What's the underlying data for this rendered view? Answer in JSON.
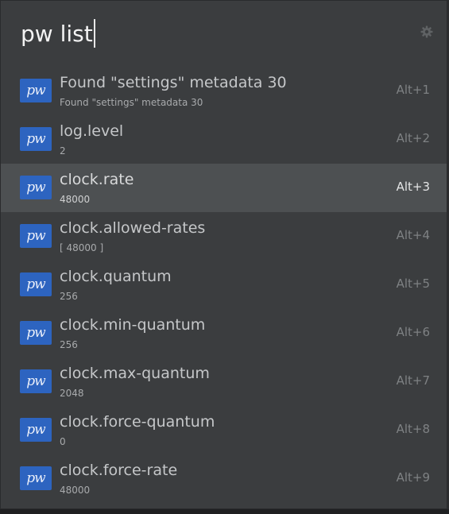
{
  "search": {
    "query": "pw list"
  },
  "icons": {
    "settings": "gear-icon",
    "app": "pipewire-icon"
  },
  "app_icon_label": "pw",
  "results": [
    {
      "title": "Found \"settings\" metadata 30",
      "subtitle": "Found \"settings\" metadata 30",
      "shortcut": "Alt+1",
      "selected": false
    },
    {
      "title": "log.level",
      "subtitle": "2",
      "shortcut": "Alt+2",
      "selected": false
    },
    {
      "title": "clock.rate",
      "subtitle": "48000",
      "shortcut": "Alt+3",
      "selected": true
    },
    {
      "title": "clock.allowed-rates",
      "subtitle": "[ 48000 ]",
      "shortcut": "Alt+4",
      "selected": false
    },
    {
      "title": "clock.quantum",
      "subtitle": "256",
      "shortcut": "Alt+5",
      "selected": false
    },
    {
      "title": "clock.min-quantum",
      "subtitle": "256",
      "shortcut": "Alt+6",
      "selected": false
    },
    {
      "title": "clock.max-quantum",
      "subtitle": "2048",
      "shortcut": "Alt+7",
      "selected": false
    },
    {
      "title": "clock.force-quantum",
      "subtitle": "0",
      "shortcut": "Alt+8",
      "selected": false
    },
    {
      "title": "clock.force-rate",
      "subtitle": "48000",
      "shortcut": "Alt+9",
      "selected": false
    }
  ],
  "colors": {
    "background": "#3b3d3f",
    "selected_row": "#4d5052",
    "icon_blue": "#2d64c0"
  }
}
